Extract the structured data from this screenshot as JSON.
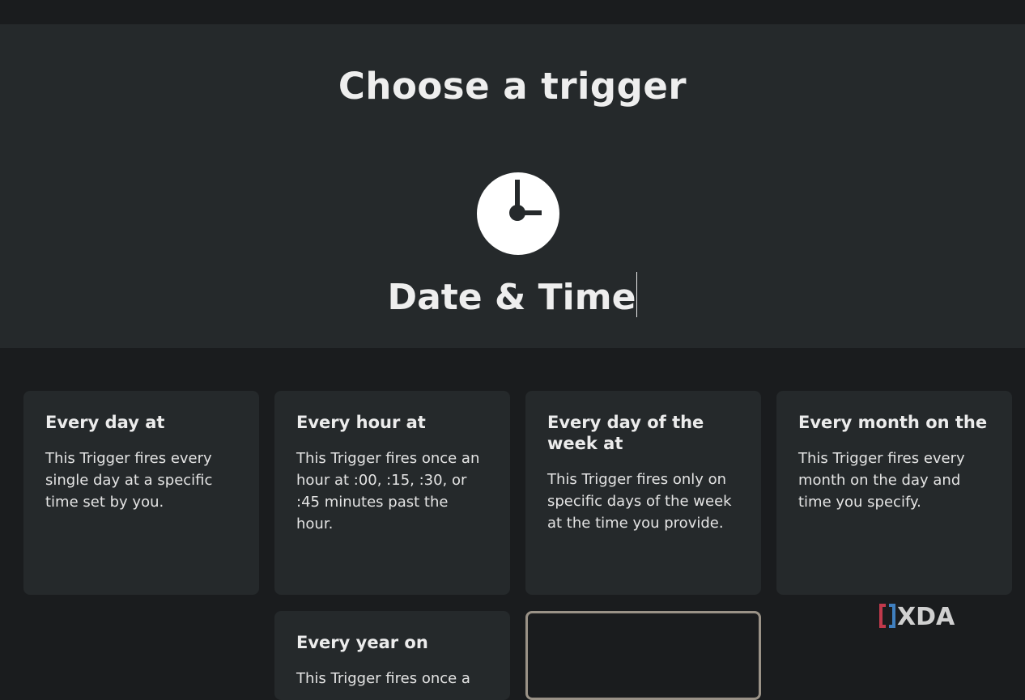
{
  "header": {
    "title": "Choose a trigger",
    "service_name": "Date & Time",
    "service_icon": "clock-icon"
  },
  "triggers": [
    {
      "title": "Every day at",
      "description": "This Trigger fires every single day at a specific time set by you."
    },
    {
      "title": "Every hour at",
      "description": "This Trigger fires once an hour at :00, :15, :30, or :45 minutes past the hour."
    },
    {
      "title": "Every day of the week at",
      "description": "This Trigger fires only on specific days of the week at the time you provide."
    },
    {
      "title": "Every month on the",
      "description": "This Trigger fires every month on the day and time you specify."
    },
    {
      "title": "Every year on",
      "description": "This Trigger fires once a"
    }
  ],
  "watermark": {
    "text": "XDA"
  },
  "colors": {
    "page_background": "#1a1c1e",
    "hero_background": "#25292b",
    "card_background": "#25292b",
    "text": "#eeeeee",
    "outline": "#9a9287",
    "watermark_accent": "#c0394b"
  }
}
